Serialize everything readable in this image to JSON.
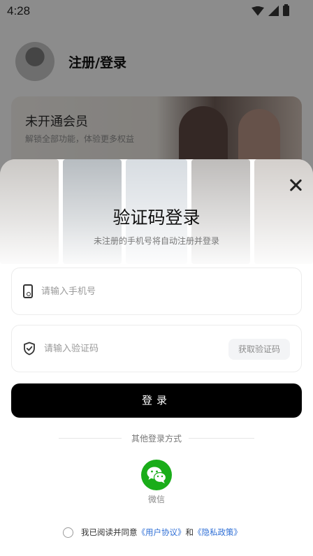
{
  "status_bar": {
    "time": "4:28"
  },
  "background": {
    "profile_name": "注册/登录",
    "vip_title": "未开通会员",
    "vip_subtitle": "解锁全部功能，体验更多权益"
  },
  "login": {
    "title": "验证码登录",
    "subtitle": "未注册的手机号将自动注册并登录",
    "phone_placeholder": "请输入手机号",
    "code_placeholder": "请输入验证码",
    "get_code_label": "获取验证码",
    "login_label": "登录",
    "other_methods": "其他登录方式",
    "wechat_label": "微信"
  },
  "agreement": {
    "prefix": "我已阅读并同意",
    "user_agreement": "《用户协议》",
    "and": "和",
    "privacy_policy": "《隐私政策》"
  },
  "colors": {
    "primary_button": "#000000",
    "wechat_green": "#1aad19",
    "link_blue": "#2f6fd6"
  },
  "icons": [
    "phone-icon",
    "shield-check-icon",
    "close-icon",
    "wechat-icon"
  ]
}
